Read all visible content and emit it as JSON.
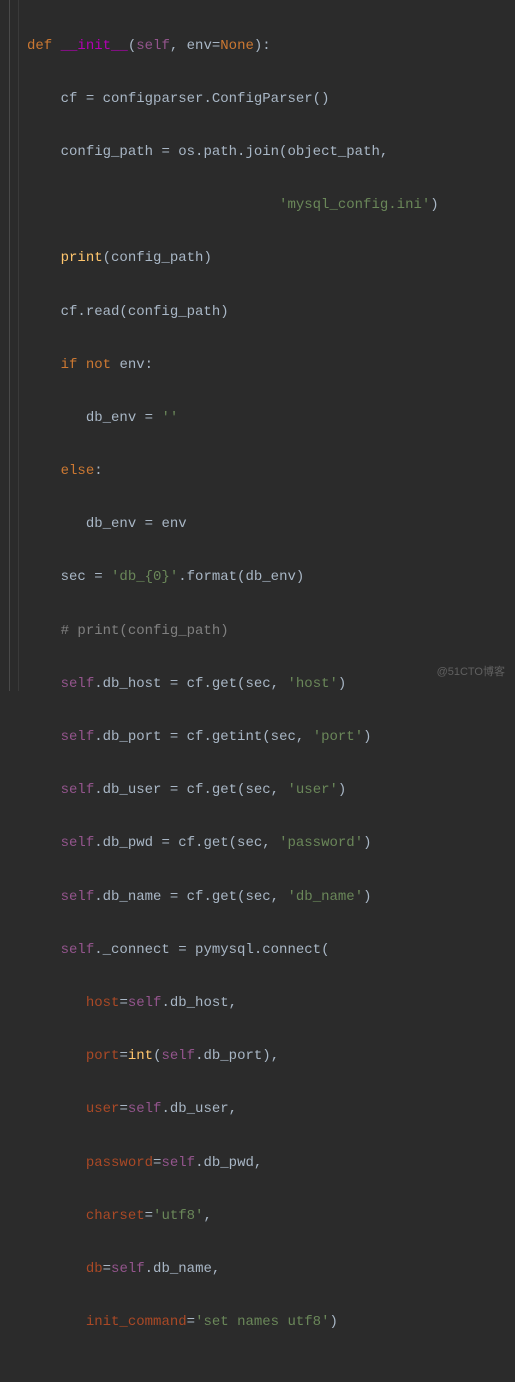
{
  "watermark": "@51CTO博客",
  "code": {
    "l1": {
      "def": "def ",
      "dunder": "__init__",
      "p": "(",
      "self": "self",
      "c1": ", ",
      "env": "env",
      "eq": "=",
      "none": "None",
      "close": "):"
    },
    "l2": {
      "a": "cf ",
      "eq": "=",
      "b": " configparser.ConfigParser()"
    },
    "l3": {
      "a": "config_path ",
      "eq": "=",
      "b": " os.path.join(object_path",
      "c": ","
    },
    "l4": {
      "s": "'mysql_config.ini'",
      "close": ")"
    },
    "l5": {
      "fn": "print",
      "p": "(config_path)"
    },
    "l6": {
      "a": "cf.read(config_path)"
    },
    "l7": {
      "kw1": "if ",
      "kw2": "not ",
      "v": "env:"
    },
    "l8": {
      "a": "db_env ",
      "eq": "=",
      "s": " ''"
    },
    "l9": {
      "kw": "else",
      "c": ":"
    },
    "l10": {
      "a": "db_env ",
      "eq": "=",
      "b": " env"
    },
    "l11": {
      "a": "sec ",
      "eq": "=",
      "s": " 'db_{0}'",
      "b": ".format(db_env)"
    },
    "l12": {
      "cmt": "# print(config_path)"
    },
    "l13": {
      "self": "self",
      "a": ".db_host ",
      "eq": "=",
      "b": " cf.get(sec",
      "c": ", ",
      "s": "'host'",
      "close": ")"
    },
    "l14": {
      "self": "self",
      "a": ".db_port ",
      "eq": "=",
      "b": " cf.getint(sec",
      "c": ", ",
      "s": "'port'",
      "close": ")"
    },
    "l15": {
      "self": "self",
      "a": ".db_user ",
      "eq": "=",
      "b": " cf.get(sec",
      "c": ", ",
      "s": "'user'",
      "close": ")"
    },
    "l16": {
      "self": "self",
      "a": ".db_pwd ",
      "eq": "=",
      "b": " cf.get(sec",
      "c": ", ",
      "s": "'password'",
      "close": ")"
    },
    "l17": {
      "self": "self",
      "a": ".db_name ",
      "eq": "=",
      "b": " cf.get(sec",
      "c": ", ",
      "s": "'db_name'",
      "close": ")"
    },
    "l18": {
      "self": "self",
      "a": "._connect ",
      "eq": "=",
      "b": " pymysql.connect("
    },
    "l19": {
      "k": "host",
      "eq": "=",
      "self": "self",
      "a": ".db_host",
      "c": ","
    },
    "l20": {
      "k": "port",
      "eq": "=",
      "fn": "int",
      "p": "(",
      "self": "self",
      "a": ".db_port)",
      "c": ","
    },
    "l21": {
      "k": "user",
      "eq": "=",
      "self": "self",
      "a": ".db_user",
      "c": ","
    },
    "l22": {
      "k": "password",
      "eq": "=",
      "self": "self",
      "a": ".db_pwd",
      "c": ","
    },
    "l23": {
      "k": "charset",
      "eq": "=",
      "s": "'utf8'",
      "c": ","
    },
    "l24": {
      "k": "db",
      "eq": "=",
      "self": "self",
      "a": ".db_name",
      "c": ","
    },
    "l25": {
      "k": "init_command",
      "eq": "=",
      "s": "'set names utf8'",
      "close": ")"
    }
  }
}
